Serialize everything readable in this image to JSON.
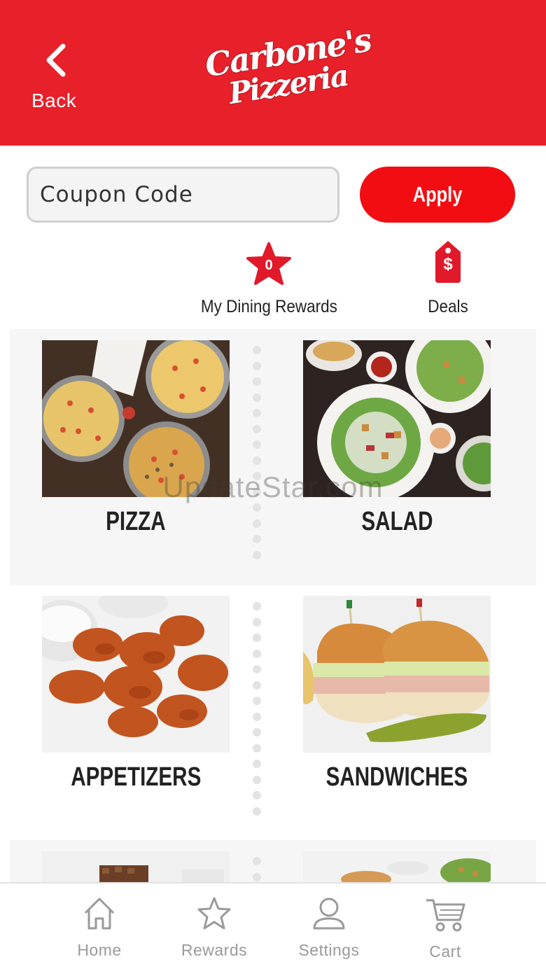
{
  "header": {
    "back_label": "Back",
    "logo_line1": "Carbone's",
    "logo_line2": "Pizzeria"
  },
  "coupon": {
    "placeholder": "Coupon Code",
    "apply_label": "Apply"
  },
  "quick_links": {
    "rewards_label": "My Dining Rewards",
    "rewards_count": "0",
    "deals_label": "Deals",
    "deals_symbol": "$"
  },
  "categories": [
    {
      "label": "PIZZA"
    },
    {
      "label": "SALAD"
    },
    {
      "label": "APPETIZERS"
    },
    {
      "label": "SANDWICHES"
    }
  ],
  "watermark": "UpdateStar.com",
  "tabbar": {
    "home": "Home",
    "rewards": "Rewards",
    "settings": "Settings",
    "cart": "Cart"
  },
  "colors": {
    "brand_red": "#e8202a",
    "apply_red": "#f20d12",
    "tab_grey": "#9a9a9a"
  }
}
